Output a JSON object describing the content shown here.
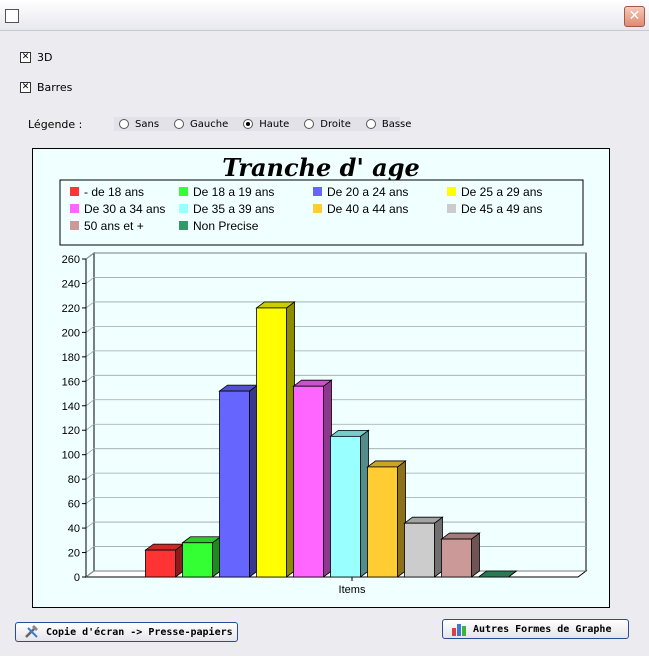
{
  "window": {
    "close_glyph": "✕"
  },
  "options": {
    "checkbox_3d": {
      "label": "3D",
      "checked": true
    },
    "checkbox_bars": {
      "label": "Barres",
      "checked": true
    },
    "legend_label": "Légende :",
    "legend_options": [
      {
        "label": "Sans",
        "selected": false
      },
      {
        "label": "Gauche",
        "selected": false
      },
      {
        "label": "Haute",
        "selected": true
      },
      {
        "label": "Droite",
        "selected": false
      },
      {
        "label": "Basse",
        "selected": false
      }
    ]
  },
  "buttons": {
    "copy_label": "Copie d'écran -> Presse-papiers",
    "other_label": "Autres Formes de Graphe"
  },
  "chart_data": {
    "type": "bar",
    "title": "Tranche d' age",
    "xlabel": "Items",
    "ylabel": "",
    "ylim": [
      0,
      260
    ],
    "ytick_step": 20,
    "grid": true,
    "three_d": true,
    "legend_position": "top",
    "series": [
      {
        "name": "- de 18 ans",
        "value": 22,
        "color": "#ff3333"
      },
      {
        "name": "De 18 a 19 ans",
        "value": 28,
        "color": "#33ff33"
      },
      {
        "name": "De 20 a 24 ans",
        "value": 152,
        "color": "#6666ff"
      },
      {
        "name": "De 25 a 29 ans",
        "value": 220,
        "color": "#ffff00"
      },
      {
        "name": "De 30 a 34 ans",
        "value": 156,
        "color": "#ff66ff"
      },
      {
        "name": "De 35 a 39 ans",
        "value": 115,
        "color": "#99ffff"
      },
      {
        "name": "De 40 a 44 ans",
        "value": 90,
        "color": "#ffcc33"
      },
      {
        "name": "De 45 a 49 ans",
        "value": 44,
        "color": "#cccccc"
      },
      {
        "name": "50 ans et +",
        "value": 31,
        "color": "#cc9999"
      },
      {
        "name": "Non Precise",
        "value": 0,
        "color": "#339966"
      }
    ]
  }
}
